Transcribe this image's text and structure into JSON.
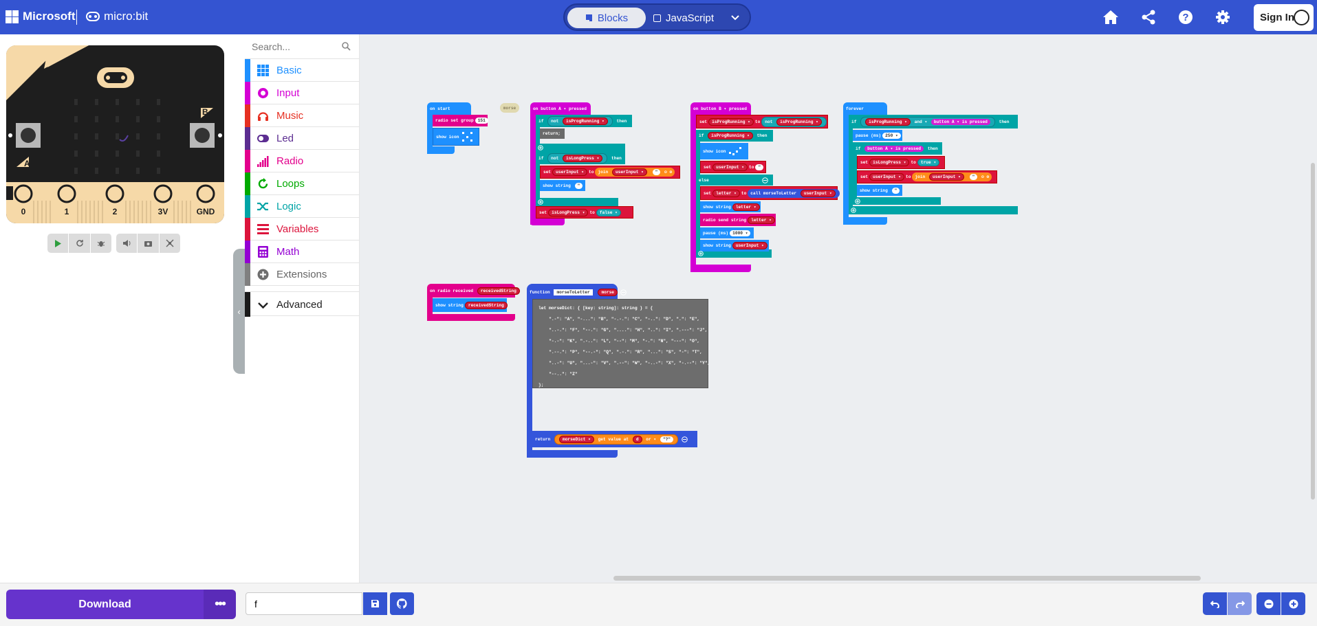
{
  "header": {
    "brand": "Microsoft",
    "product": "micro:bit",
    "tabs": {
      "blocks": "Blocks",
      "javascript": "JavaScript"
    },
    "sign_in": "Sign In"
  },
  "simulator": {
    "pins": [
      "0",
      "1",
      "2",
      "3V",
      "GND"
    ],
    "buttons": {
      "a": "A",
      "b": "B"
    }
  },
  "toolbox": {
    "search_placeholder": "Search...",
    "categories": [
      {
        "label": "Basic",
        "color": "#1e90ff"
      },
      {
        "label": "Input",
        "color": "#d400d4"
      },
      {
        "label": "Music",
        "color": "#e63022"
      },
      {
        "label": "Led",
        "color": "#5c2d91"
      },
      {
        "label": "Radio",
        "color": "#e3008c"
      },
      {
        "label": "Loops",
        "color": "#00aa00"
      },
      {
        "label": "Logic",
        "color": "#00a4a6"
      },
      {
        "label": "Variables",
        "color": "#dc143c"
      },
      {
        "label": "Math",
        "color": "#9400d3"
      },
      {
        "label": "Extensions",
        "color": "#808080"
      },
      {
        "label": "Advanced",
        "color": "#222222"
      }
    ]
  },
  "workspace": {
    "on_start": {
      "title": "on start",
      "radio_set_group": "radio set group",
      "group": "151",
      "show_icon": "show icon"
    },
    "morse_tag": "morse",
    "button_a": {
      "title": "on button  A ▾  pressed",
      "if1": "if",
      "not1": "not",
      "var1": "isProgRunning ▾",
      "then": "then",
      "return": "return;",
      "not2": "not",
      "var2": "isLongPress ▾",
      "set1": "set",
      "user_input": "userInput ▾",
      "to": "to",
      "join": "join",
      "user_input2": "userInput ▾",
      "show_string": "show string",
      "set2": "set",
      "long_press": "isLongPress ▾",
      "false": "false ▾"
    },
    "button_b": {
      "title": "on button  B ▾  pressed",
      "set": "set",
      "running": "isProgRunning ▾",
      "to": "to",
      "not": "not",
      "running2": "isProgRunning ▾",
      "if": "if",
      "running3": "isProgRunning ▾",
      "then": "then",
      "show_icon": "show icon",
      "set_user": "set",
      "user_input": "userInput ▾",
      "else": "else",
      "set_letter": "set",
      "letter": "letter ▾",
      "call": "call morseToLetter",
      "user_input2": "userInput ▾",
      "show_string": "show string",
      "letter2": "letter ▾",
      "radio_send": "radio send string",
      "letter3": "letter ▾",
      "pause": "pause (ms)",
      "pause_value": "1000 ▾",
      "show_string2": "show string",
      "user_input3": "userInput ▾"
    },
    "forever": {
      "title": "forever",
      "if": "if",
      "running": "isProgRunning ▾",
      "and": "and ▾",
      "button": "button  A ▾  is pressed",
      "then": "then",
      "pause": "pause (ms)",
      "pause_value": "250 ▾",
      "if2": "if",
      "button2": "button  A ▾  is pressed",
      "then2": "then",
      "set1": "set",
      "long_press": "isLongPress ▾",
      "to": "to",
      "true": "true ▾",
      "set2": "set",
      "user_input": "userInput ▾",
      "join": "join",
      "user_input2": "userInput ▾",
      "show_string": "show string"
    },
    "radio_received": {
      "title": "on radio received",
      "param": "receivedString",
      "show_string": "show string",
      "value": "receivedString"
    },
    "function": {
      "title": "function",
      "name": "morseToLetter",
      "param": "morse",
      "code_lines": [
        "let morseDict: { [key: string]: string } = {",
        "    \".-\": \"A\", \"-...\": \"B\", \"-.-.\": \"C\", \"-..\": \"D\", \".\": \"E\",",
        "    \"..-.\": \"F\", \"--.\": \"G\", \"....\": \"H\", \"..\": \"I\", \".---\": \"J\",",
        "    \"-.-\": \"K\", \".-..\": \"L\", \"--\": \"M\", \"-.\": \"N\", \"---\": \"O\",",
        "    \".--.\": \"P\", \"--.-\": \"Q\", \".-.\": \"R\", \"...\": \"S\", \"-\": \"T\",",
        "    \"..-\": \"U\", \"...-\": \"V\", \".--\": \"W\", \"-..-\": \"X\", \"-.--\": \"Y\",",
        "    \"--..\": \"Z\"",
        "};"
      ],
      "return": "return",
      "dict": "morseDict ▾",
      "get_value": "get value at",
      "key": "d",
      "or": "or ▾",
      "default": "\"?\""
    }
  },
  "bottom": {
    "download": "Download",
    "project_name": "f"
  }
}
